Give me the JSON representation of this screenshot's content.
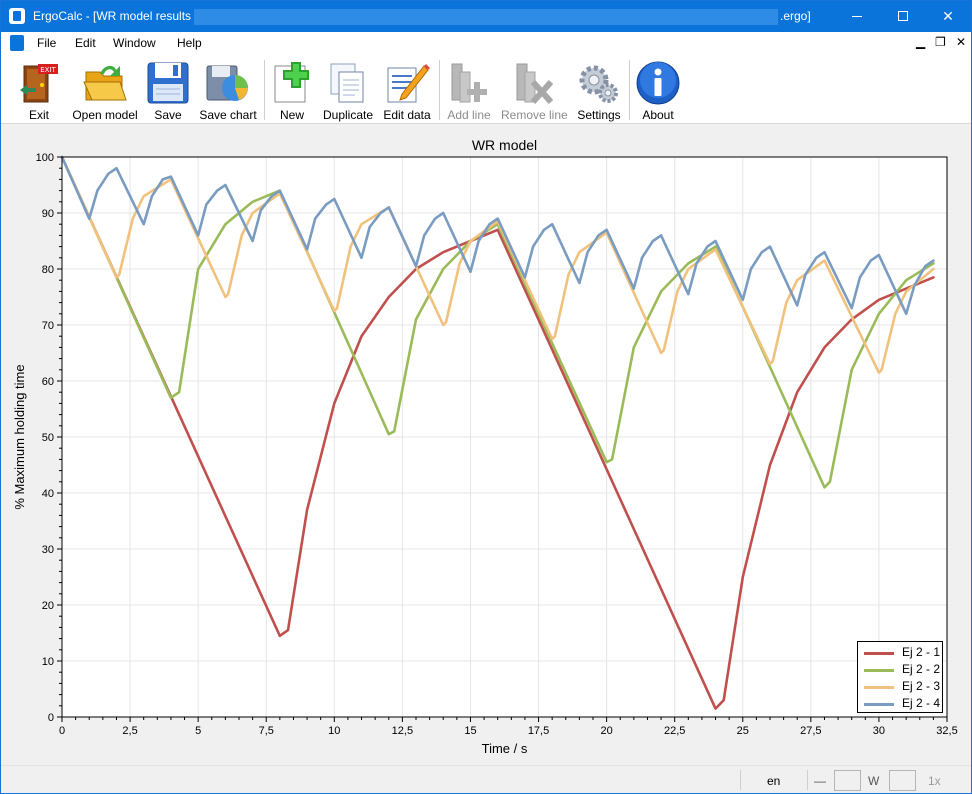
{
  "window": {
    "title_prefix": "ErgoCalc - [WR model results -",
    "title_suffix": ".ergo]"
  },
  "menu": [
    "File",
    "Edit",
    "Window",
    "Help"
  ],
  "toolbar": {
    "exit": "Exit",
    "open_model": "Open model",
    "save": "Save",
    "save_chart": "Save chart",
    "new": "New",
    "duplicate": "Duplicate",
    "edit_data": "Edit data",
    "add_line": "Add line",
    "remove_line": "Remove line",
    "settings": "Settings",
    "about": "About"
  },
  "icons": {
    "exit": "exit-door-icon",
    "open_model": "open-folder-icon",
    "save": "floppy-disk-icon",
    "save_chart": "save-chart-icon",
    "new": "new-document-icon",
    "duplicate": "duplicate-icon",
    "edit_data": "edit-pencil-icon",
    "add_line": "add-line-icon",
    "remove_line": "remove-line-icon",
    "settings": "gear-icon",
    "about": "info-icon"
  },
  "colors": {
    "titlebar": "#0a74da",
    "series1": "#c0504d",
    "series2": "#9bbb59",
    "series3": "#f1c27d",
    "series4": "#7a9cc0"
  },
  "chart_data": {
    "type": "line",
    "title": "WR model",
    "xlabel": "Time / s",
    "ylabel": "% Maximum holding time",
    "xlim": [
      0,
      32.5
    ],
    "ylim": [
      0,
      100
    ],
    "xticks": [
      "0",
      "2,5",
      "5",
      "7,5",
      "10",
      "12,5",
      "15",
      "17,5",
      "20",
      "22,5",
      "25",
      "27,5",
      "30",
      "32,5"
    ],
    "yticks": [
      "0",
      "10",
      "20",
      "30",
      "40",
      "50",
      "60",
      "70",
      "80",
      "90",
      "100"
    ],
    "grid": true,
    "legend_position": "bottom-right",
    "series": [
      {
        "name": "Ej 2 - 1",
        "color": "#c0504d",
        "points": [
          [
            0,
            100
          ],
          [
            8,
            14.5
          ],
          [
            8.3,
            15.5
          ],
          [
            9,
            37
          ],
          [
            10,
            56
          ],
          [
            11,
            68
          ],
          [
            12,
            75
          ],
          [
            13,
            80
          ],
          [
            14,
            83
          ],
          [
            15,
            85
          ],
          [
            16,
            87
          ],
          [
            24,
            1.5
          ],
          [
            24.3,
            3
          ],
          [
            25,
            25
          ],
          [
            26,
            45
          ],
          [
            27,
            58
          ],
          [
            28,
            66
          ],
          [
            29,
            71
          ],
          [
            30,
            74.5
          ],
          [
            31,
            76.5
          ],
          [
            32,
            78.5
          ]
        ]
      },
      {
        "name": "Ej 2 - 2",
        "color": "#9bbb59",
        "points": [
          [
            0,
            100
          ],
          [
            4,
            57
          ],
          [
            4.3,
            58
          ],
          [
            5,
            80
          ],
          [
            6,
            88
          ],
          [
            7,
            92
          ],
          [
            8,
            94
          ],
          [
            12,
            50.5
          ],
          [
            12.2,
            51
          ],
          [
            13,
            71
          ],
          [
            14,
            80
          ],
          [
            15,
            85
          ],
          [
            16,
            88
          ],
          [
            20,
            45.5
          ],
          [
            20.2,
            46
          ],
          [
            21,
            66
          ],
          [
            22,
            76
          ],
          [
            23,
            81
          ],
          [
            24,
            84
          ],
          [
            28,
            41
          ],
          [
            28.2,
            42
          ],
          [
            29,
            62
          ],
          [
            30,
            72
          ],
          [
            31,
            78
          ],
          [
            32,
            81
          ]
        ]
      },
      {
        "name": "Ej 2 - 3",
        "color": "#f1c27d",
        "points": [
          [
            0,
            100
          ],
          [
            2,
            78.5
          ],
          [
            2.1,
            79
          ],
          [
            2.6,
            89
          ],
          [
            3,
            93
          ],
          [
            4,
            96
          ],
          [
            6,
            75
          ],
          [
            6.1,
            75.5
          ],
          [
            6.6,
            86
          ],
          [
            7,
            90
          ],
          [
            8,
            93.5
          ],
          [
            10,
            72.5
          ],
          [
            10.1,
            73
          ],
          [
            10.6,
            84
          ],
          [
            11,
            88
          ],
          [
            12,
            91
          ],
          [
            14,
            70
          ],
          [
            14.1,
            70.5
          ],
          [
            14.6,
            81
          ],
          [
            15,
            85
          ],
          [
            16,
            88.5
          ],
          [
            18,
            67.5
          ],
          [
            18.1,
            68
          ],
          [
            18.6,
            79
          ],
          [
            19,
            83
          ],
          [
            20,
            86.5
          ],
          [
            22,
            65
          ],
          [
            22.1,
            65.5
          ],
          [
            22.6,
            76
          ],
          [
            23,
            80
          ],
          [
            24,
            83.5
          ],
          [
            26,
            63
          ],
          [
            26.1,
            63.5
          ],
          [
            26.6,
            74
          ],
          [
            27,
            78
          ],
          [
            28,
            81.5
          ],
          [
            30,
            61.5
          ],
          [
            30.1,
            62
          ],
          [
            30.6,
            72
          ],
          [
            31,
            76
          ],
          [
            32,
            80
          ]
        ]
      },
      {
        "name": "Ej 2 - 4",
        "color": "#7a9cc0",
        "points": [
          [
            0,
            100
          ],
          [
            1,
            89
          ],
          [
            1.3,
            94
          ],
          [
            1.7,
            97
          ],
          [
            2,
            98
          ],
          [
            3,
            88
          ],
          [
            3.3,
            93
          ],
          [
            3.7,
            96
          ],
          [
            4,
            96.5
          ],
          [
            5,
            86
          ],
          [
            5.3,
            91.5
          ],
          [
            5.7,
            94
          ],
          [
            6,
            95
          ],
          [
            7,
            85
          ],
          [
            7.3,
            90.5
          ],
          [
            7.7,
            93
          ],
          [
            8,
            94
          ],
          [
            9,
            83.5
          ],
          [
            9.3,
            89
          ],
          [
            9.7,
            91.5
          ],
          [
            10,
            92.5
          ],
          [
            11,
            82
          ],
          [
            11.3,
            87.5
          ],
          [
            11.7,
            90
          ],
          [
            12,
            91
          ],
          [
            13,
            80.5
          ],
          [
            13.3,
            86
          ],
          [
            13.7,
            89
          ],
          [
            14,
            90
          ],
          [
            15,
            79.5
          ],
          [
            15.3,
            85
          ],
          [
            15.7,
            88
          ],
          [
            16,
            89
          ],
          [
            17,
            78.5
          ],
          [
            17.3,
            84
          ],
          [
            17.7,
            87
          ],
          [
            18,
            88
          ],
          [
            19,
            77.5
          ],
          [
            19.3,
            83
          ],
          [
            19.7,
            86
          ],
          [
            20,
            87
          ],
          [
            21,
            76.5
          ],
          [
            21.3,
            82
          ],
          [
            21.7,
            85
          ],
          [
            22,
            86
          ],
          [
            23,
            75.5
          ],
          [
            23.3,
            81
          ],
          [
            23.7,
            84
          ],
          [
            24,
            85
          ],
          [
            25,
            74.5
          ],
          [
            25.3,
            80
          ],
          [
            25.7,
            83
          ],
          [
            26,
            84
          ],
          [
            27,
            73.5
          ],
          [
            27.3,
            79
          ],
          [
            27.7,
            82
          ],
          [
            28,
            83
          ],
          [
            29,
            73
          ],
          [
            29.3,
            78.5
          ],
          [
            29.7,
            81.5
          ],
          [
            30,
            82.5
          ],
          [
            31,
            72
          ],
          [
            31.3,
            77
          ],
          [
            31.7,
            80.5
          ],
          [
            32,
            81.5
          ]
        ]
      }
    ]
  },
  "status": {
    "language": "en",
    "dash": "—",
    "w_label": "W",
    "zoom": "1x"
  }
}
